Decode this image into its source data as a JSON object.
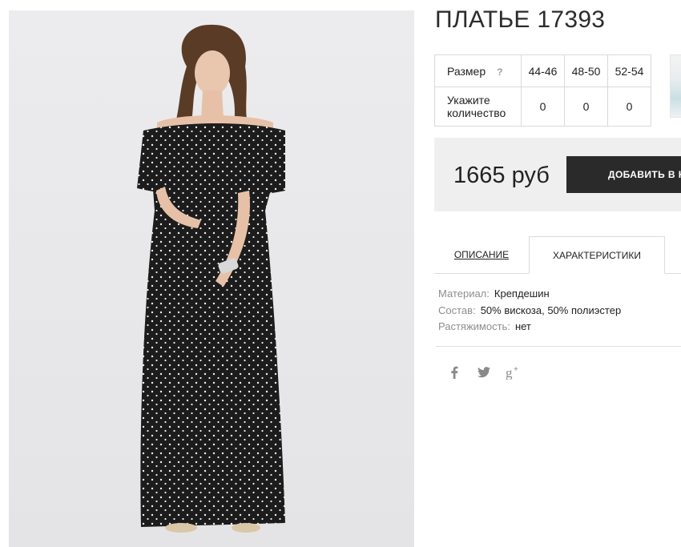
{
  "product": {
    "title": "ПЛАТЬЕ 17393"
  },
  "size_table": {
    "size_label": "Размер",
    "help_mark": "?",
    "qty_label_line1": "Укажите",
    "qty_label_line2": "количество",
    "sizes": [
      "44-46",
      "48-50",
      "52-54"
    ],
    "quantities": [
      "0",
      "0",
      "0"
    ]
  },
  "buy": {
    "price": "1665 руб",
    "cart_label": "ДОБАВИТЬ В КОРЗИНУ"
  },
  "tabs": {
    "description": "ОПИСАНИЕ",
    "characteristics": "ХАРАКТЕРИСТИКИ"
  },
  "specs": [
    {
      "key": "Материал:",
      "value": "Крепдешин"
    },
    {
      "key": "Состав:",
      "value": "50% вискоза, 50% полиэстер"
    },
    {
      "key": "Растяжимость:",
      "value": "нет"
    }
  ],
  "share": {
    "icons": [
      "facebook-icon",
      "twitter-icon",
      "google-plus-icon"
    ]
  },
  "colors": {
    "dress": "#1c1c1c",
    "buy_bg": "#efefef",
    "cart_btn": "#2a2a2a",
    "photo_bg": "#e8e8ea"
  }
}
